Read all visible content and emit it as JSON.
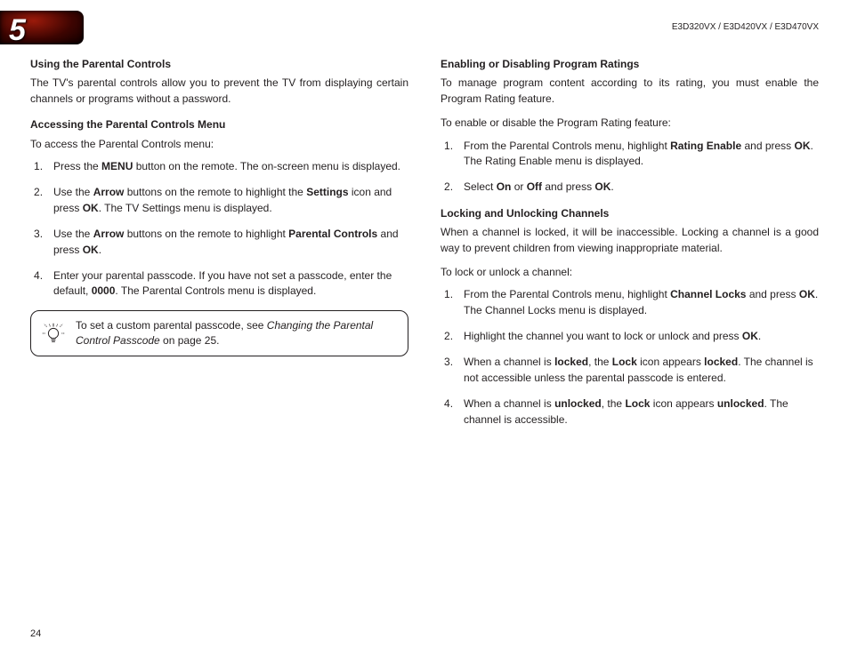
{
  "chapter": "5",
  "models": "E3D320VX / E3D420VX / E3D470VX",
  "pageNumber": "24",
  "left": {
    "h1": "Using the Parental Controls",
    "p1": "The TV's parental controls allow you to prevent the TV from displaying certain channels or programs without a password.",
    "h2": "Accessing the Parental Controls Menu",
    "p2": "To access the Parental Controls menu:",
    "steps": {
      "s1a": "Press the ",
      "s1b": "MENU",
      "s1c": " button on the remote. The on-screen menu is displayed.",
      "s2a": "Use the ",
      "s2b": "Arrow",
      "s2c": " buttons on the remote to highlight the ",
      "s2d": "Settings",
      "s2e": " icon and press ",
      "s2f": "OK",
      "s2g": ". The TV Settings menu is displayed.",
      "s3a": "Use the ",
      "s3b": "Arrow",
      "s3c": " buttons on the remote to highlight ",
      "s3d": "Parental Controls",
      "s3e": " and press ",
      "s3f": "OK",
      "s3g": ".",
      "s4a": "Enter your parental passcode. If you have not set a passcode, enter the default, ",
      "s4b": "0000",
      "s4c": ". The Parental Controls menu is displayed."
    },
    "tip": {
      "a": "To set a custom parental passcode, see ",
      "b": "Changing the Parental Control Passcode",
      "c": " on page 25."
    }
  },
  "right": {
    "h1": "Enabling or Disabling Program Ratings",
    "p1": "To manage program content according to its rating, you must enable the Program Rating feature.",
    "p2": "To enable or disable the Program Rating feature:",
    "stepsA": {
      "s1a": "From the Parental Controls menu, highlight ",
      "s1b": "Rating Enable",
      "s1c": " and press ",
      "s1d": "OK",
      "s1e": ". The Rating Enable menu is displayed.",
      "s2a": "Select ",
      "s2b": "On",
      "s2c": " or ",
      "s2d": "Off",
      "s2e": " and press ",
      "s2f": "OK",
      "s2g": "."
    },
    "h2": "Locking and Unlocking Channels",
    "p3": "When a channel is locked, it will be inaccessible. Locking a channel is a good way to prevent children from viewing inappropriate material.",
    "p4": "To lock or unlock a channel:",
    "stepsB": {
      "s1a": "From the Parental Controls menu, highlight ",
      "s1b": "Channel Locks",
      "s1c": " and press ",
      "s1d": "OK",
      "s1e": ". The Channel Locks menu is displayed.",
      "s2a": "Highlight the channel you want to lock or unlock and press ",
      "s2b": "OK",
      "s2c": ".",
      "s3a": "When a channel is ",
      "s3b": "locked",
      "s3c": ", the ",
      "s3d": "Lock",
      "s3e": " icon appears ",
      "s3f": "locked",
      "s3g": ". The channel is not accessible unless the parental passcode is entered.",
      "s4a": "When a channel is ",
      "s4b": "unlocked",
      "s4c": ", the ",
      "s4d": "Lock",
      "s4e": " icon appears ",
      "s4f": "unlocked",
      "s4g": ". The channel is accessible."
    }
  }
}
